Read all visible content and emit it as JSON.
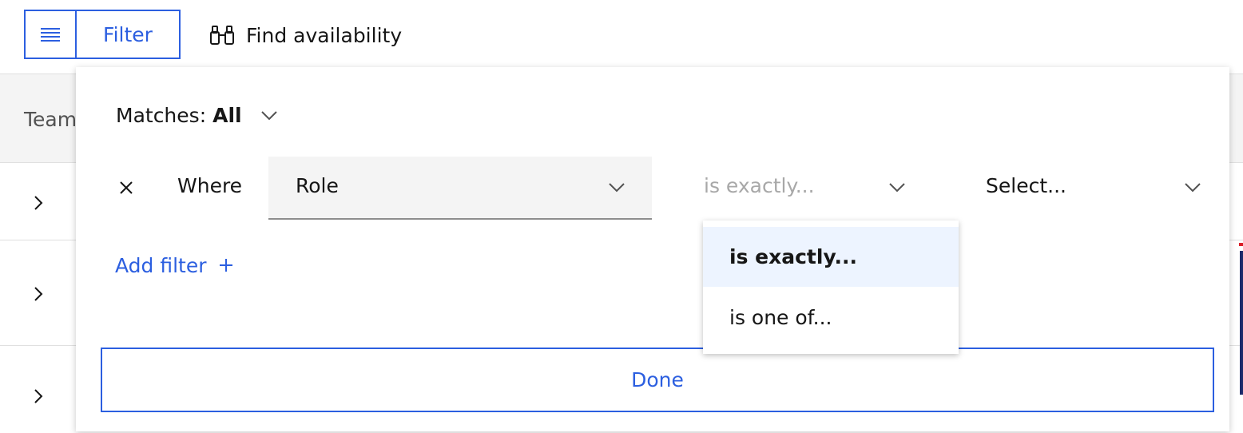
{
  "toolbar": {
    "menu_icon": "hamburger-icon",
    "filter_label": "Filter",
    "find_icon": "binoculars-icon",
    "find_label": "Find availability",
    "accent_color": "#2c5fe0"
  },
  "table": {
    "first_column_label": "Team",
    "row_expand_icon": "chevron-right-icon",
    "header_bg": "#f4f4f4"
  },
  "filter_panel": {
    "matches_label": "Matches:",
    "matches_value": "All",
    "matches_icon": "chevron-down-icon",
    "condition": {
      "remove_icon": "close-icon",
      "where_label": "Where",
      "field_value": "Role",
      "operator_placeholder": "is exactly...",
      "value_placeholder": "Select..."
    },
    "add_filter_label": "Add filter",
    "add_filter_icon": "plus-icon",
    "done_label": "Done"
  },
  "operator_menu": {
    "options": [
      {
        "label": "is exactly...",
        "selected": true
      },
      {
        "label": "is one of...",
        "selected": false
      }
    ],
    "selected_bg": "#edf4ff"
  }
}
